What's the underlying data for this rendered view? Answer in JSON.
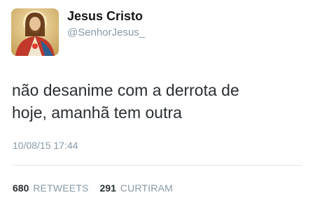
{
  "author": {
    "display_name": "Jesus Cristo",
    "handle": "@SenhorJesus_",
    "avatar_icon": "jesus-portrait"
  },
  "tweet": {
    "text_line_1": "não desanime com a derrota de",
    "text_line_2": "hoje, amanhã tem outra",
    "timestamp": "10/08/15 17:44"
  },
  "stats": {
    "retweets_count": "680",
    "retweets_label": "RETWEETS",
    "likes_count": "291",
    "likes_label": "CURTIRAM"
  },
  "colors": {
    "text": "#292f33",
    "muted": "#8899a6",
    "divider": "#e1e8ed"
  }
}
